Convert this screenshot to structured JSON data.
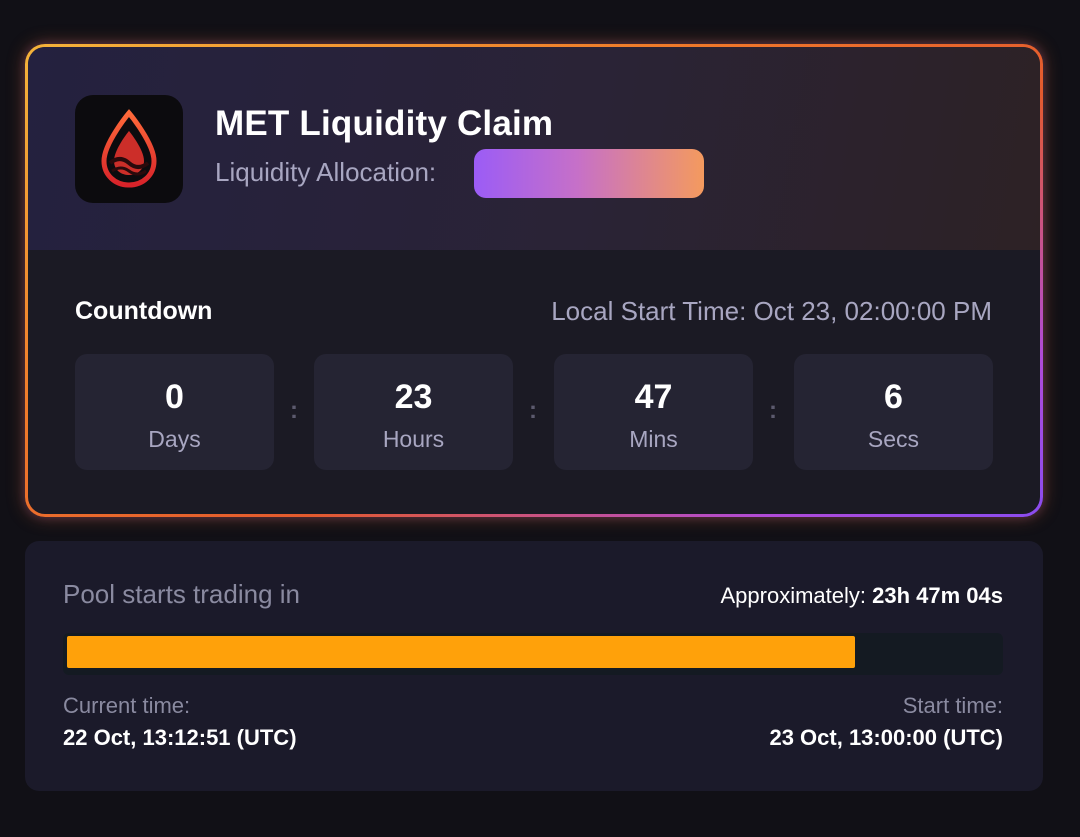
{
  "claim": {
    "title": "MET Liquidity Claim",
    "allocation_label": "Liquidity Allocation:",
    "app_icon": "liquidity-drop-icon",
    "allocation_gradient": [
      "#9b5cf6",
      "#f49a5e"
    ]
  },
  "countdown": {
    "label": "Countdown",
    "local_start": "Local Start Time: Oct 23, 02:00:00 PM",
    "separator": ":",
    "units": [
      {
        "value": "0",
        "label": "Days"
      },
      {
        "value": "23",
        "label": "Hours"
      },
      {
        "value": "47",
        "label": "Mins"
      },
      {
        "value": "6",
        "label": "Secs"
      }
    ]
  },
  "pool": {
    "label": "Pool starts trading in",
    "approx_prefix": "Approximately:",
    "approx_value": "23h 47m 04s",
    "progress_fraction": 0.845,
    "progress_color": "#ffa10a",
    "current_time_label": "Current time:",
    "current_time_value": "22 Oct, 13:12:51 (UTC)",
    "start_time_label": "Start time:",
    "start_time_value": "23 Oct, 13:00:00 (UTC)"
  },
  "colors": {
    "background": "#111016",
    "card": "#1b1a24",
    "muted_text": "#a8a6c1"
  }
}
